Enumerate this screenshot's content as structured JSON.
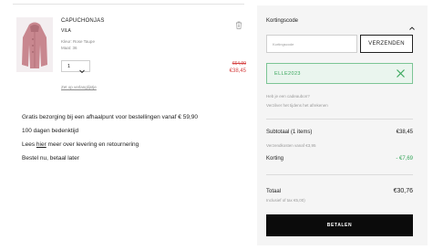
{
  "item": {
    "name": "CAPUCHONJAS",
    "brand": "VILA",
    "color": "Kleur: Rose Taupe",
    "size": "Maat: 36",
    "quantity": "1",
    "price_old": "€64,99",
    "price_new": "€38,45",
    "wishlist_link": "Zet op verlanglijstje",
    "thumbnail_icon": "pink-coat-thumbnail"
  },
  "info_lines": {
    "shipping": "Gratis bezorging bij een afhaalpunt voor bestellingen vanaf € 59,90",
    "returns_period": "100 dagen bedenktijd",
    "more_pre": "Lees ",
    "more_link": "hier",
    "more_post": " meer over levering en retournering",
    "pay_later": "Bestel nu, betaal later"
  },
  "summary": {
    "discount_title": "Kortingscode",
    "discount_placeholder": "Kortingscode",
    "discount_button": "VERZENDEN",
    "applied_code": "ELLE2023",
    "gift_question": "Heb je een cadeaubon?",
    "gift_answer": "Verzilver het tijdens het afrekenen",
    "subtotal_label": "Subtotaal (1 items)",
    "subtotal_value": "€38,45",
    "shipping_note": "Verzendkosten vanaf €3,95",
    "discount_label": "Korting",
    "discount_value": "- €7,69",
    "total_label": "Totaal",
    "total_value": "€30,76",
    "tax_note": "Inclusief of tax €5,00)",
    "pay_button": "BETALEN"
  },
  "colors": {
    "sale_red": "#d64545",
    "success_green": "#3aa75d",
    "panel_bg": "#f5f5f5",
    "pay_button_bg": "#0b0b0b"
  }
}
